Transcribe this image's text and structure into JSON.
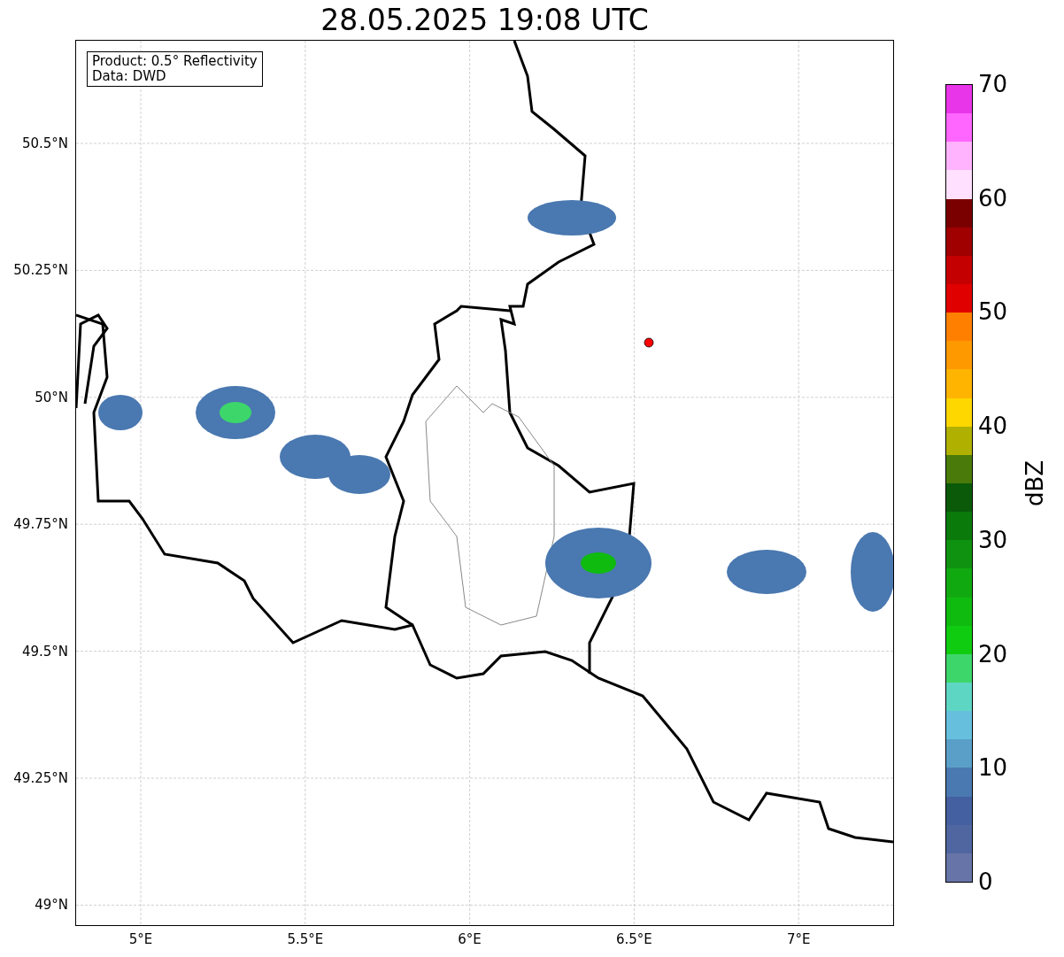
{
  "title": "28.05.2025 19:08 UTC",
  "legend": [
    "Product: 0.5° Reflectivity",
    "Data: DWD"
  ],
  "lat_labels": [
    "50.5°N",
    "50.25°N",
    "50°N",
    "49.75°N",
    "49.5°N",
    "49.25°N",
    "49°N"
  ],
  "lon_labels": [
    "5°E",
    "5.5°E",
    "6°E",
    "6.5°E",
    "7°E"
  ],
  "colorbar": {
    "label": "dBZ",
    "ticks": [
      "70",
      "60",
      "50",
      "40",
      "30",
      "20",
      "10",
      "0"
    ],
    "segments": [
      {
        "color": "#6674a8"
      },
      {
        "color": "#5066a0"
      },
      {
        "color": "#4460a0"
      },
      {
        "color": "#4a78b0"
      },
      {
        "color": "#5a9fc8"
      },
      {
        "color": "#66c0dd"
      },
      {
        "color": "#5ed6c4"
      },
      {
        "color": "#3dd66b"
      },
      {
        "color": "#10cc10"
      },
      {
        "color": "#10bb10"
      },
      {
        "color": "#10aa10"
      },
      {
        "color": "#0f920f"
      },
      {
        "color": "#0a7a0a"
      },
      {
        "color": "#0a5a0a"
      },
      {
        "color": "#4a7a0a"
      },
      {
        "color": "#b0b000"
      },
      {
        "color": "#ffd700"
      },
      {
        "color": "#ffb400"
      },
      {
        "color": "#ff9900"
      },
      {
        "color": "#ff7f00"
      },
      {
        "color": "#e00000"
      },
      {
        "color": "#c40000"
      },
      {
        "color": "#a00000"
      },
      {
        "color": "#7a0000"
      },
      {
        "color": "#ffe0ff"
      },
      {
        "color": "#ffb3ff"
      },
      {
        "color": "#ff66ff"
      },
      {
        "color": "#e935e9"
      }
    ]
  }
}
